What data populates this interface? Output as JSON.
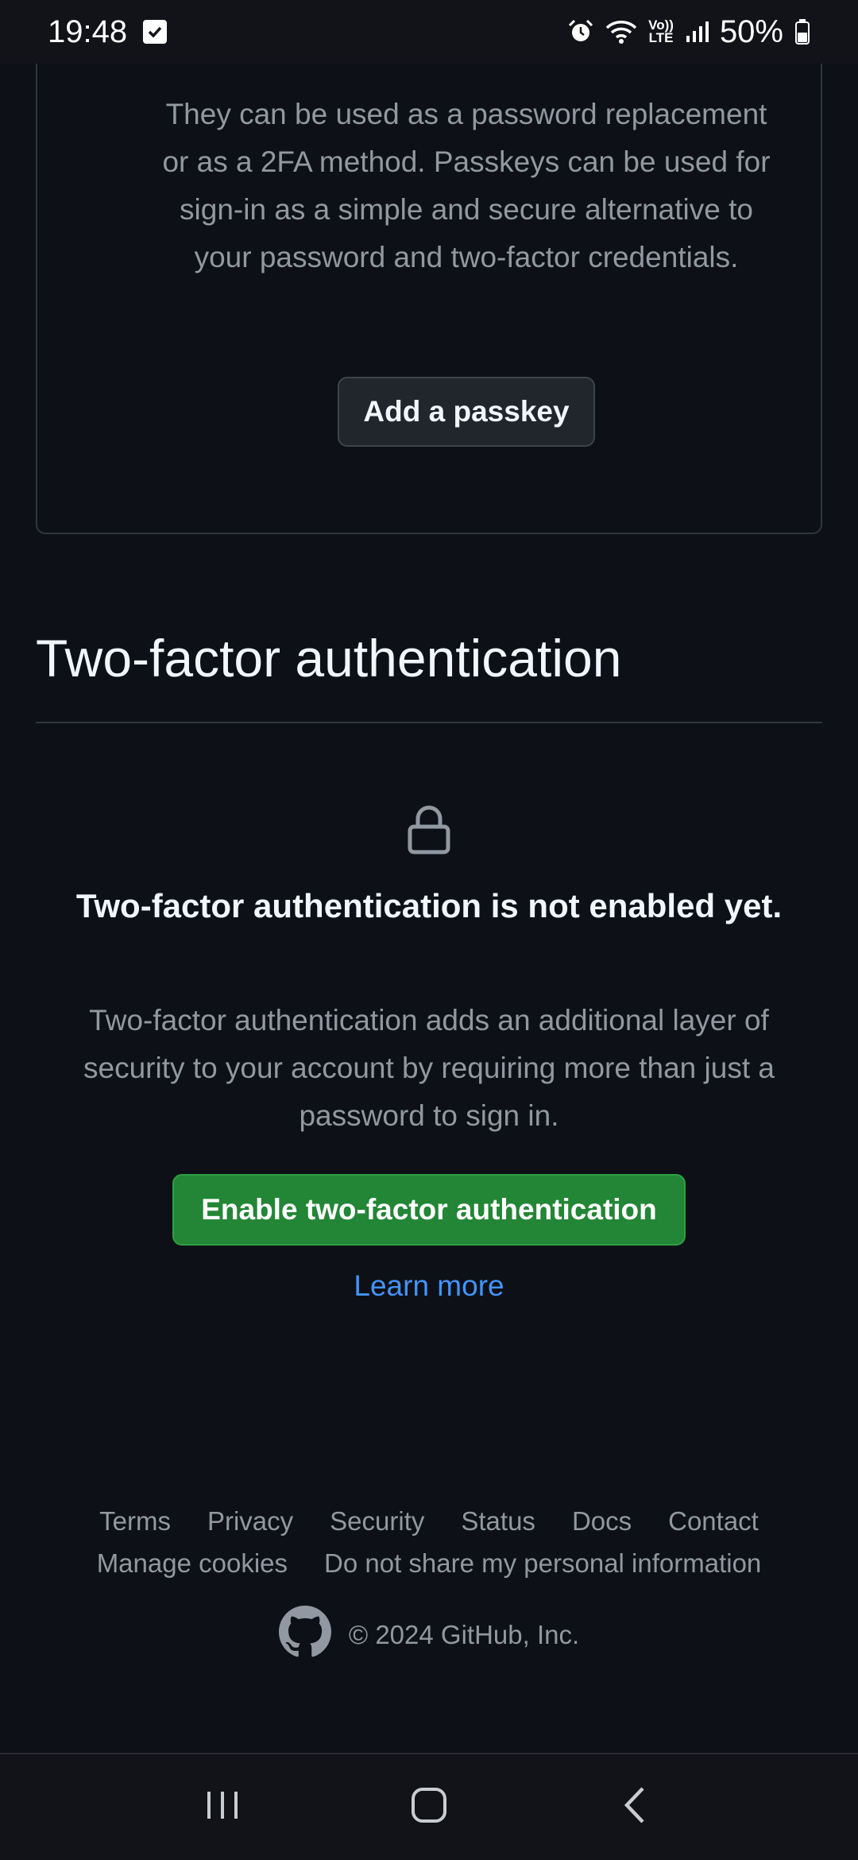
{
  "status_bar": {
    "time": "19:48",
    "battery": "50%",
    "volte_top": "Vo))",
    "volte_bottom": "LTE",
    "icons": [
      "check-notification-icon",
      "alarm-icon",
      "wifi-icon",
      "volte-icon",
      "signal-icon",
      "battery-icon"
    ]
  },
  "passkeys": {
    "description": "They can be used as a password replacement or as a 2FA method. Passkeys can be used for sign-in as a simple and secure alternative to your password and two-factor credentials.",
    "add_button": "Add a passkey"
  },
  "two_factor": {
    "title": "Two-factor authentication",
    "icon": "lock-icon",
    "heading": "Two-factor authentication is not enabled yet.",
    "description": "Two-factor authentication adds an additional layer of security to your account by requiring more than just a password to sign in.",
    "enable_button": "Enable two-factor authentication",
    "learn_more": "Learn more"
  },
  "footer": {
    "links_row1": [
      "Terms",
      "Privacy",
      "Security",
      "Status",
      "Docs",
      "Contact"
    ],
    "links_row2": [
      "Manage cookies",
      "Do not share my personal information"
    ],
    "copyright": "© 2024 GitHub, Inc.",
    "logo_icon": "github-logo-icon"
  },
  "nav_bar": {
    "icons": [
      "recent-apps-icon",
      "home-icon",
      "back-icon"
    ]
  },
  "colors": {
    "background": "#0d1117",
    "accent_green": "#238636",
    "link_blue": "#4493f8",
    "muted_text": "#9198a1"
  }
}
